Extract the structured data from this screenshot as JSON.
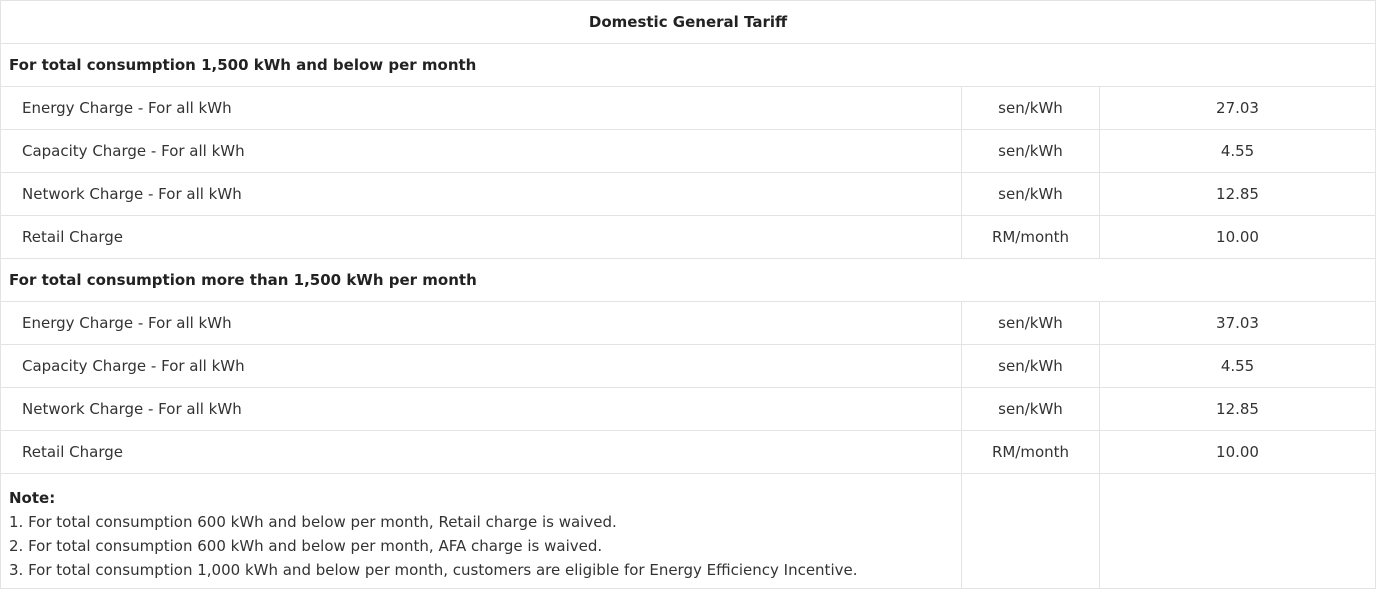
{
  "table": {
    "title": "Domestic General Tariff",
    "sections": [
      {
        "heading": "For total consumption 1,500 kWh and below per month",
        "rows": [
          {
            "label": "Energy Charge - For all kWh",
            "unit": "sen/kWh",
            "value": "27.03"
          },
          {
            "label": "Capacity Charge - For all kWh",
            "unit": "sen/kWh",
            "value": "4.55"
          },
          {
            "label": "Network Charge - For all kWh",
            "unit": "sen/kWh",
            "value": "12.85"
          },
          {
            "label": "Retail Charge",
            "unit": "RM/month",
            "value": "10.00"
          }
        ]
      },
      {
        "heading": "For total consumption more than 1,500 kWh per month",
        "rows": [
          {
            "label": "Energy Charge - For all kWh",
            "unit": "sen/kWh",
            "value": "37.03"
          },
          {
            "label": "Capacity Charge - For all kWh",
            "unit": "sen/kWh",
            "value": "4.55"
          },
          {
            "label": "Network Charge - For all kWh",
            "unit": "sen/kWh",
            "value": "12.85"
          },
          {
            "label": "Retail Charge",
            "unit": "RM/month",
            "value": "10.00"
          }
        ]
      }
    ],
    "note": {
      "title": "Note:",
      "items": [
        "1. For total consumption 600 kWh and below per month, Retail charge is waived.",
        "2. For total consumption 600 kWh and below per month, AFA charge is waived.",
        "3. For total consumption 1,000 kWh and below per month, customers are eligible for Energy Efficiency Incentive."
      ]
    }
  }
}
